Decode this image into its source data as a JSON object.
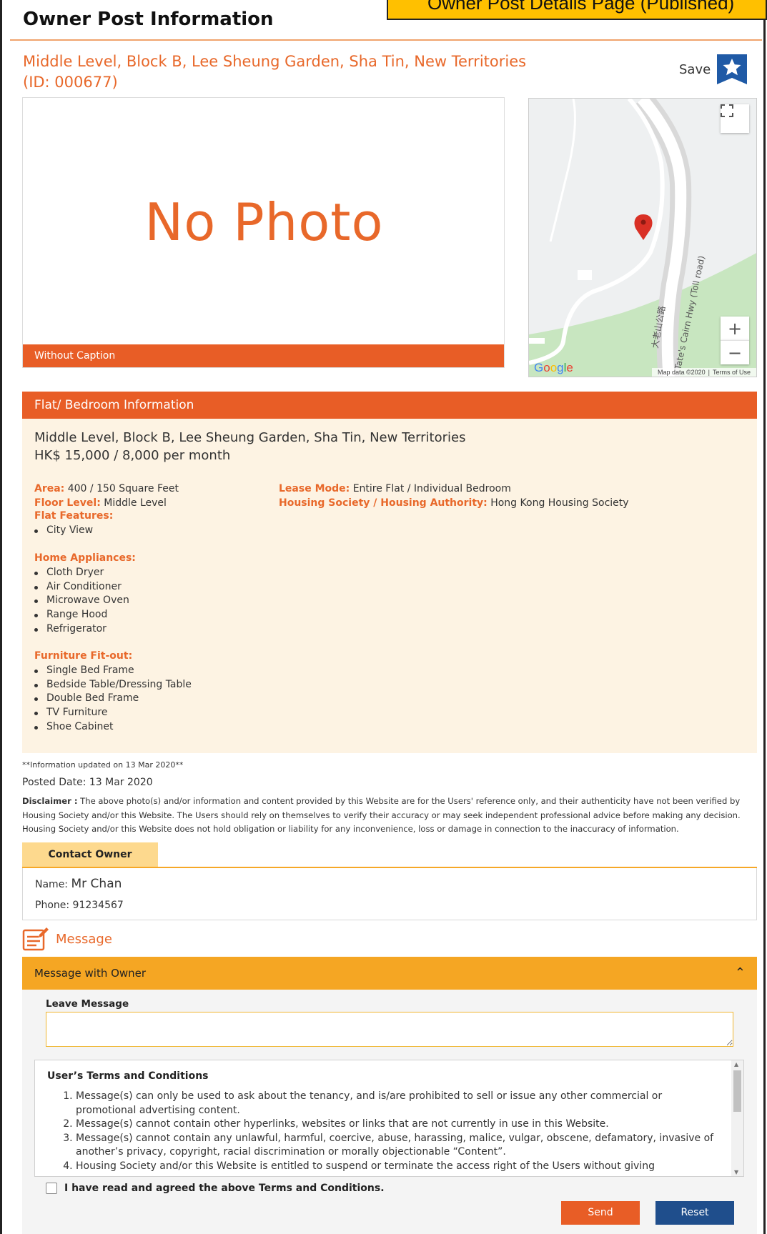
{
  "banner": {
    "text": "Owner Post Details Page (Published)"
  },
  "page_title": "Owner Post Information",
  "listing": {
    "address": "Middle Level, Block B, Lee Sheung Garden, Sha Tin, New Territories",
    "id_text": "(ID: 000677)",
    "save_label": "Save",
    "save_icon": "star-icon"
  },
  "photo": {
    "placeholder": "No Photo",
    "caption": "Without Caption"
  },
  "map": {
    "google_logo": "Google",
    "map_data": "Map data ©2020",
    "terms": "Terms of Use",
    "road_label_cn": "大老山公路",
    "road_label_en": "Tate's Cairn Hwy (Toll road)",
    "zoom_in": "+",
    "zoom_out": "−",
    "colors": {
      "park": "#c8e6c0",
      "road": "#ffffff",
      "marker": "#d93025"
    }
  },
  "flat_info": {
    "header": "Flat/ Bedroom Information",
    "address": "Middle Level, Block B, Lee Sheung Garden, Sha Tin, New Territories",
    "price": "HK$ 15,000 / 8,000 per month",
    "area_label": "Area:",
    "area_value": "400 / 150 Square Feet",
    "floor_label": "Floor Level:",
    "floor_value": "Middle Level",
    "lease_label": "Lease Mode:",
    "lease_value": "Entire Flat / Individual Bedroom",
    "society_label": "Housing Society / Housing Authority:",
    "society_value": "Hong Kong Housing Society",
    "features_title": "Flat Features:",
    "features": [
      "City View"
    ],
    "appliances_title": "Home Appliances:",
    "appliances": [
      "Cloth Dryer",
      "Air Conditioner",
      "Microwave Oven",
      "Range Hood",
      "Refrigerator"
    ],
    "furniture_title": "Furniture Fit-out:",
    "furniture": [
      "Single Bed Frame",
      "Bedside Table/Dressing Table",
      "Double Bed Frame",
      "TV Furniture",
      "Shoe Cabinet"
    ]
  },
  "meta": {
    "updated": "**Information updated on 13 Mar 2020**",
    "posted": "Posted Date: 13 Mar 2020",
    "disclaimer_label": "Disclaimer :",
    "disclaimer_text": "The above photo(s) and/or information and content provided by this Website are for the Users' reference only, and their authenticity have not been verified by Housing Society and/or this Website. The Users should rely on themselves to verify their accuracy or may seek independent professional advice before making any decision. Housing Society and/or this Website does not hold obligation or liability for any inconvenience, loss or damage in connection to the inaccuracy of information."
  },
  "contact": {
    "tab": "Contact Owner",
    "name_label": "Name:",
    "name_value": "Mr Chan",
    "phone_label": "Phone:",
    "phone_value": "91234567"
  },
  "message": {
    "section_title": "Message",
    "accordion_title": "Message with Owner",
    "leave_label": "Leave Message",
    "input_value": "",
    "terms_title": "User’s Terms and Conditions",
    "terms": [
      "Message(s) can only be used to ask about the tenancy, and is/are prohibited to sell or issue any other commercial or promotional advertising content.",
      "Message(s) cannot contain other hyperlinks, websites or links that are not currently in use in this Website.",
      "Message(s) cannot contain any unlawful, harmful, coercive, abuse, harassing, malice, vulgar, obscene, defamatory, invasive of another’s privacy, copyright, racial discrimination or morally objectionable “Content”.",
      "Housing Society and/or this Website is entitled to suspend or terminate the access right of the Users without giving"
    ],
    "agree_text": "I have read and agreed the above Terms and Conditions.",
    "agree_checked": false,
    "send_label": "Send",
    "reset_label": "Reset"
  }
}
